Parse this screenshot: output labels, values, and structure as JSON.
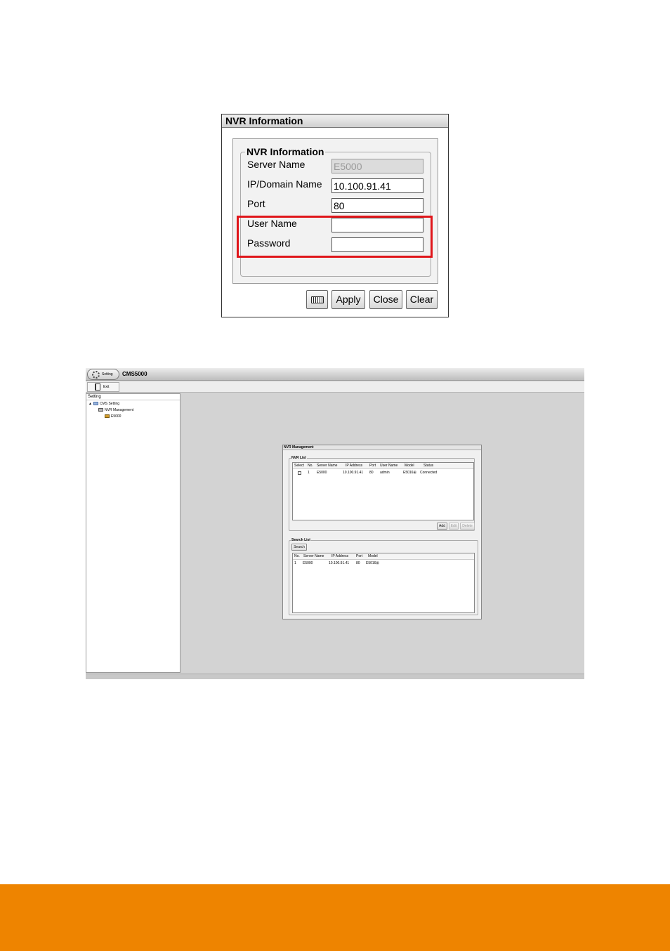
{
  "nvr_dialog": {
    "title": "NVR Information",
    "group_label": "NVR Information",
    "fields": [
      {
        "label": "Server Name",
        "value": "E5000",
        "disabled": true
      },
      {
        "label": "IP/Domain Name",
        "value": "10.100.91.41",
        "disabled": false
      },
      {
        "label": "Port",
        "value": "80",
        "disabled": false
      },
      {
        "label": "User Name",
        "value": "",
        "disabled": false
      },
      {
        "label": "Password",
        "value": "",
        "disabled": false
      }
    ],
    "buttons": {
      "apply": "Apply",
      "close": "Close",
      "clear": "Clear"
    },
    "highlight_color": "#e0151a"
  },
  "cms_app": {
    "setting_tab": "Setting",
    "title": "CMS5000",
    "exit_label": "Exit",
    "tree": {
      "header": "Setting",
      "expand_glyph": "▲",
      "nodes": [
        "CMS Setting",
        "NVR Management",
        "E5000"
      ]
    },
    "nvr_management": {
      "title": "NVR Management",
      "nvr_list": {
        "label": "NVR List",
        "columns": [
          "Select",
          "No.",
          "Server Name",
          "IP Address",
          "Port",
          "User Name",
          "Model",
          "Status"
        ],
        "rows": [
          {
            "no": "1",
            "server_name": "E5000",
            "ip": "10.100.91.41",
            "port": "80",
            "user": "admin",
            "model": "E5016⊞",
            "status": "Connected"
          }
        ],
        "buttons": {
          "add": "Add",
          "edit": "Edit",
          "delete": "Delete"
        }
      },
      "search_list": {
        "label": "Search List",
        "search_button": "Search",
        "columns": [
          "No.",
          "Server Name",
          "IP Address",
          "Port",
          "Model"
        ],
        "rows": [
          {
            "no": "1",
            "server_name": "E5000",
            "ip": "10.100.91.41",
            "port": "80",
            "model": "E5016⊞"
          }
        ]
      }
    }
  },
  "footer_color": "#ee8400"
}
